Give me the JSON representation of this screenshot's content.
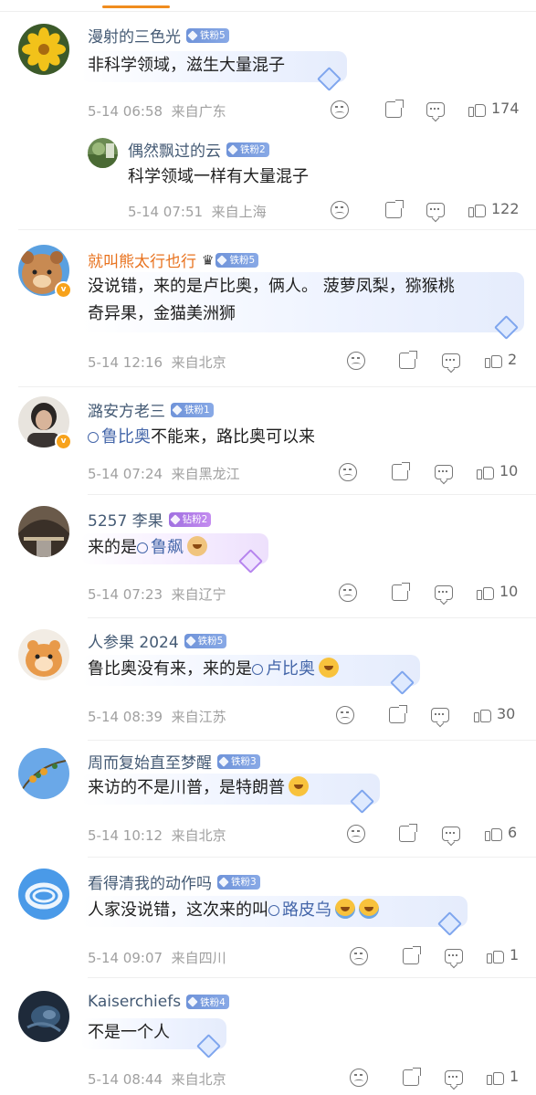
{
  "comments": [
    {
      "name": "漫射的三色光",
      "fan": "铁粉5",
      "text": "非科学领域，滋生大量混子",
      "time": "5-14 06:58",
      "loc": "来自广东",
      "likes": "174"
    },
    {
      "name": "偶然飘过的云",
      "fan": "铁粉2",
      "text": "科学领域一样有大量混子",
      "time": "5-14 07:51",
      "loc": "来自上海",
      "likes": "122"
    },
    {
      "name": "就叫熊太行也行",
      "fan": "铁粉5",
      "text1": "没说错，来的是卢比奥，俩人。 菠萝凤梨，猕猴桃",
      "text2": "奇异果，金猫美洲狮",
      "time": "5-14 12:16",
      "loc": "来自北京",
      "likes": "2"
    },
    {
      "name": "潞安方老三",
      "fan": "铁粉1",
      "link": "鲁比奥",
      "text": "不能来，路比奥可以来",
      "time": "5-14 07:24",
      "loc": "来自黑龙江",
      "likes": "10"
    },
    {
      "name": "5257 李果",
      "fan": "钻粉2",
      "text": "来的是",
      "link": "鲁飙",
      "time": "5-14 07:23",
      "loc": "来自辽宁",
      "likes": "10"
    },
    {
      "name": "人参果 2024",
      "fan": "铁粉5",
      "text": "鲁比奥没有来，来的是",
      "link": "卢比奥",
      "time": "5-14 08:39",
      "loc": "来自江苏",
      "likes": "30"
    },
    {
      "name": "周而复始直至梦醒",
      "fan": "铁粉3",
      "text": "来访的不是川普，是特朗普",
      "time": "5-14 10:12",
      "loc": "来自北京",
      "likes": "6"
    },
    {
      "name": "看得清我的动作吗",
      "fan": "铁粉3",
      "text": "人家没说错，这次来的叫",
      "link": "路皮乌",
      "time": "5-14 09:07",
      "loc": "来自四川",
      "likes": "1"
    },
    {
      "name": "Kaiserchiefs",
      "fan": "铁粉4",
      "text": "不是一个人",
      "time": "5-14 08:44",
      "loc": "来自北京",
      "likes": "1"
    }
  ],
  "icons": {
    "dislike": "sad-face-icon",
    "share": "share-icon",
    "comment": "comment-icon",
    "like": "thumbs-up-icon"
  },
  "colors": {
    "username": "#445a74",
    "username_highlight": "#e8721e",
    "link": "#4466a9",
    "meta": "#a0a0a0",
    "fan_badge": "#7b9ce0",
    "diamond_badge": "#b07ee8"
  }
}
